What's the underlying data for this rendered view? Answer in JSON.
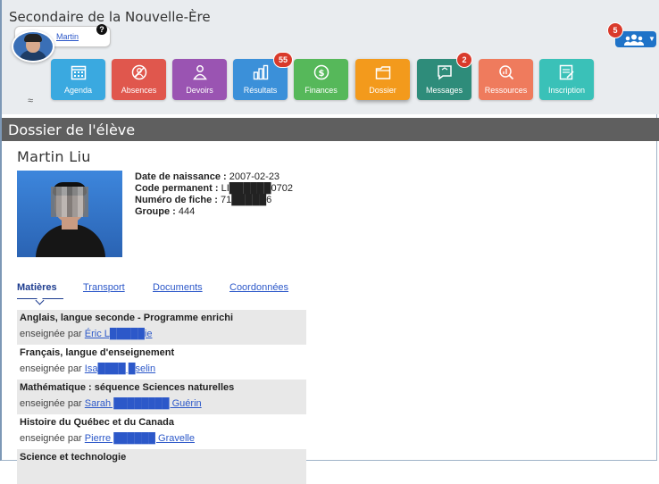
{
  "header": {
    "school_name": "Secondaire de la Nouvelle-Ère",
    "user_name": "Martin",
    "help_badge": "?",
    "group_badge": "5",
    "collapse_symbol": "≈"
  },
  "tiles": [
    {
      "label": "Agenda",
      "color": "#3aa9e0",
      "icon": "calendar-icon",
      "badge": ""
    },
    {
      "label": "Absences",
      "color": "#e0574d",
      "icon": "absence-icon",
      "badge": ""
    },
    {
      "label": "Devoirs",
      "color": "#9a54b2",
      "icon": "homework-icon",
      "badge": ""
    },
    {
      "label": "Résultats",
      "color": "#3b90d9",
      "icon": "results-chart-icon",
      "badge": "55"
    },
    {
      "label": "Finances",
      "color": "#56b85a",
      "icon": "money-icon",
      "badge": ""
    },
    {
      "label": "Dossier",
      "color": "#f39a1c",
      "icon": "folder-icon",
      "badge": ""
    },
    {
      "label": "Messages",
      "color": "#2e8c7a",
      "icon": "message-icon",
      "badge": "2"
    },
    {
      "label": "Ressources",
      "color": "#ef7b5d",
      "icon": "resources-icon",
      "badge": ""
    },
    {
      "label": "Inscription",
      "color": "#3ac1b8",
      "icon": "inscription-icon",
      "badge": ""
    }
  ],
  "section": {
    "title": "Dossier de l'élève"
  },
  "student": {
    "name": "Martin Liu",
    "dob_label": "Date de naissance :",
    "dob_value": "2007-02-23",
    "code_label": "Code permanent :",
    "code_value": "LI██████0702",
    "fiche_label": "Numéro de fiche :",
    "fiche_value": "71█████6",
    "group_label": "Groupe :",
    "group_value": "444"
  },
  "tabs": [
    "Matières",
    "Transport",
    "Documents",
    "Coordonnées"
  ],
  "taught_by_label": "enseignée par",
  "courses": [
    {
      "name": "Anglais, langue seconde - Programme enrichi",
      "teacher": "Éric L█████ie"
    },
    {
      "name": "Français, langue d'enseignement",
      "teacher": "Isa████ █selin"
    },
    {
      "name": "Mathématique : séquence Sciences naturelles",
      "teacher": "Sarah ████████ Guérin"
    },
    {
      "name": "Histoire du Québec et du Canada",
      "teacher": "Pierre ██████ Gravelle"
    },
    {
      "name": "Science et technologie",
      "teacher": ""
    }
  ],
  "colors": {
    "header_bg": "#e9ecef",
    "section_bar": "#5f5f5f",
    "link": "#2c58c9",
    "badge": "#d93a2b"
  }
}
